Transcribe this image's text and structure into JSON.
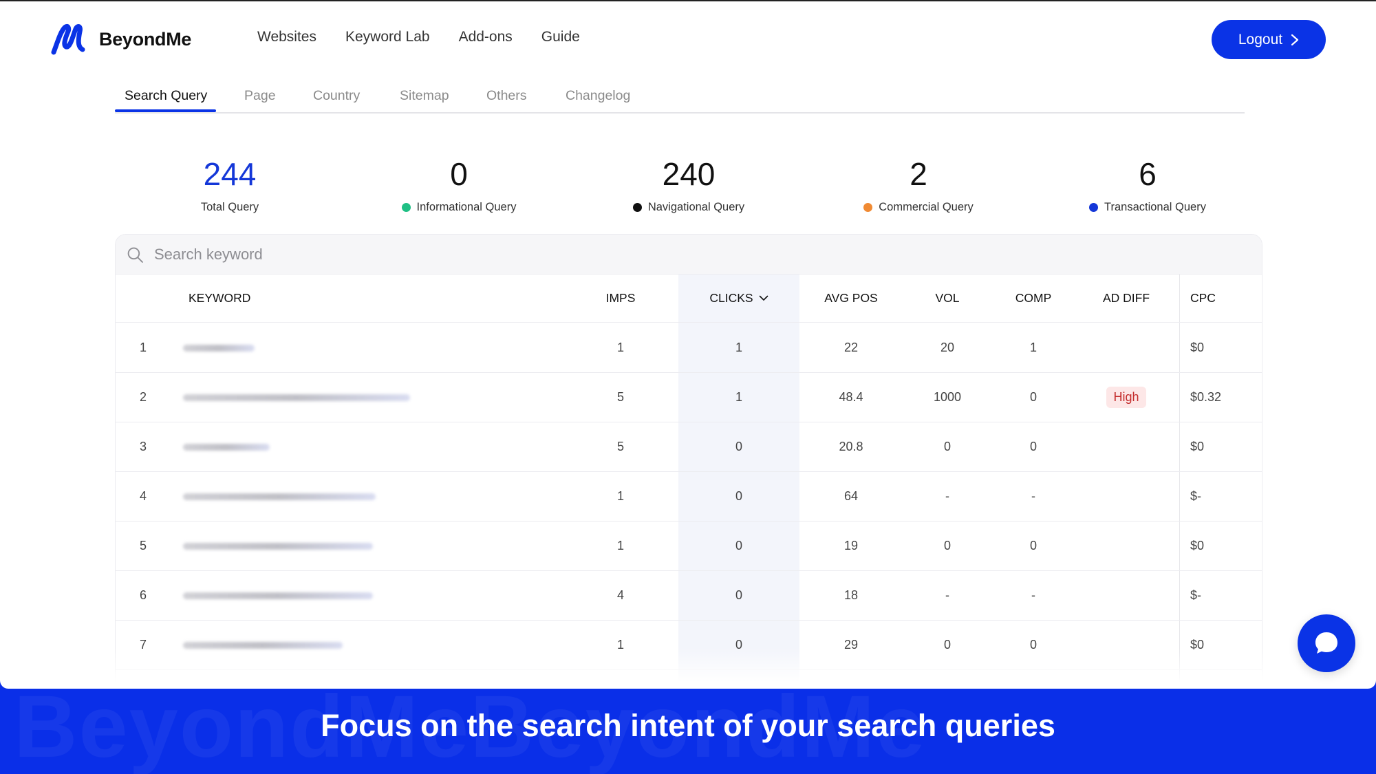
{
  "brand": {
    "name": "BeyondMe",
    "accent": "#0a33e6"
  },
  "nav": {
    "items": [
      "Websites",
      "Keyword Lab",
      "Add-ons",
      "Guide"
    ]
  },
  "logout": {
    "label": "Logout"
  },
  "subtabs": [
    "Search Query",
    "Page",
    "Country",
    "Sitemap",
    "Others",
    "Changelog"
  ],
  "active_subtab": "Search Query",
  "stats": [
    {
      "value": "244",
      "label": "Total Query",
      "color": ""
    },
    {
      "value": "0",
      "label": "Informational Query",
      "color": "#1fbf84"
    },
    {
      "value": "240",
      "label": "Navigational Query",
      "color": "#111111"
    },
    {
      "value": "2",
      "label": "Commercial Query",
      "color": "#f08a33"
    },
    {
      "value": "6",
      "label": "Transactional Query",
      "color": "#1437d8"
    }
  ],
  "search": {
    "placeholder": "Search keyword"
  },
  "table": {
    "columns": {
      "keyword": "KEYWORD",
      "imps": "IMPS",
      "clicks": "CLICKS",
      "avg_pos": "AVG POS",
      "vol": "VOL",
      "comp": "COMP",
      "ad_diff": "AD DIFF",
      "cpc": "CPC"
    },
    "rows": [
      {
        "idx": "1",
        "imps": "1",
        "clicks": "1",
        "avg_pos": "22",
        "vol": "20",
        "comp": "1",
        "ad_diff": "",
        "cpc": "$0"
      },
      {
        "idx": "2",
        "imps": "5",
        "clicks": "1",
        "avg_pos": "48.4",
        "vol": "1000",
        "comp": "0",
        "ad_diff": "High",
        "cpc": "$0.32"
      },
      {
        "idx": "3",
        "imps": "5",
        "clicks": "0",
        "avg_pos": "20.8",
        "vol": "0",
        "comp": "0",
        "ad_diff": "",
        "cpc": "$0"
      },
      {
        "idx": "4",
        "imps": "1",
        "clicks": "0",
        "avg_pos": "64",
        "vol": "-",
        "comp": "-",
        "ad_diff": "",
        "cpc": "$-"
      },
      {
        "idx": "5",
        "imps": "1",
        "clicks": "0",
        "avg_pos": "19",
        "vol": "0",
        "comp": "0",
        "ad_diff": "",
        "cpc": "$0"
      },
      {
        "idx": "6",
        "imps": "4",
        "clicks": "0",
        "avg_pos": "18",
        "vol": "-",
        "comp": "-",
        "ad_diff": "",
        "cpc": "$-"
      },
      {
        "idx": "7",
        "imps": "1",
        "clicks": "0",
        "avg_pos": "29",
        "vol": "0",
        "comp": "0",
        "ad_diff": "",
        "cpc": "$0"
      }
    ]
  },
  "banner": {
    "text": "Focus on the search intent of your search queries"
  },
  "icons": {
    "search": "search-icon",
    "chat": "chat-icon",
    "chevron": "chevron-right-icon",
    "sort": "chevron-down-icon"
  }
}
